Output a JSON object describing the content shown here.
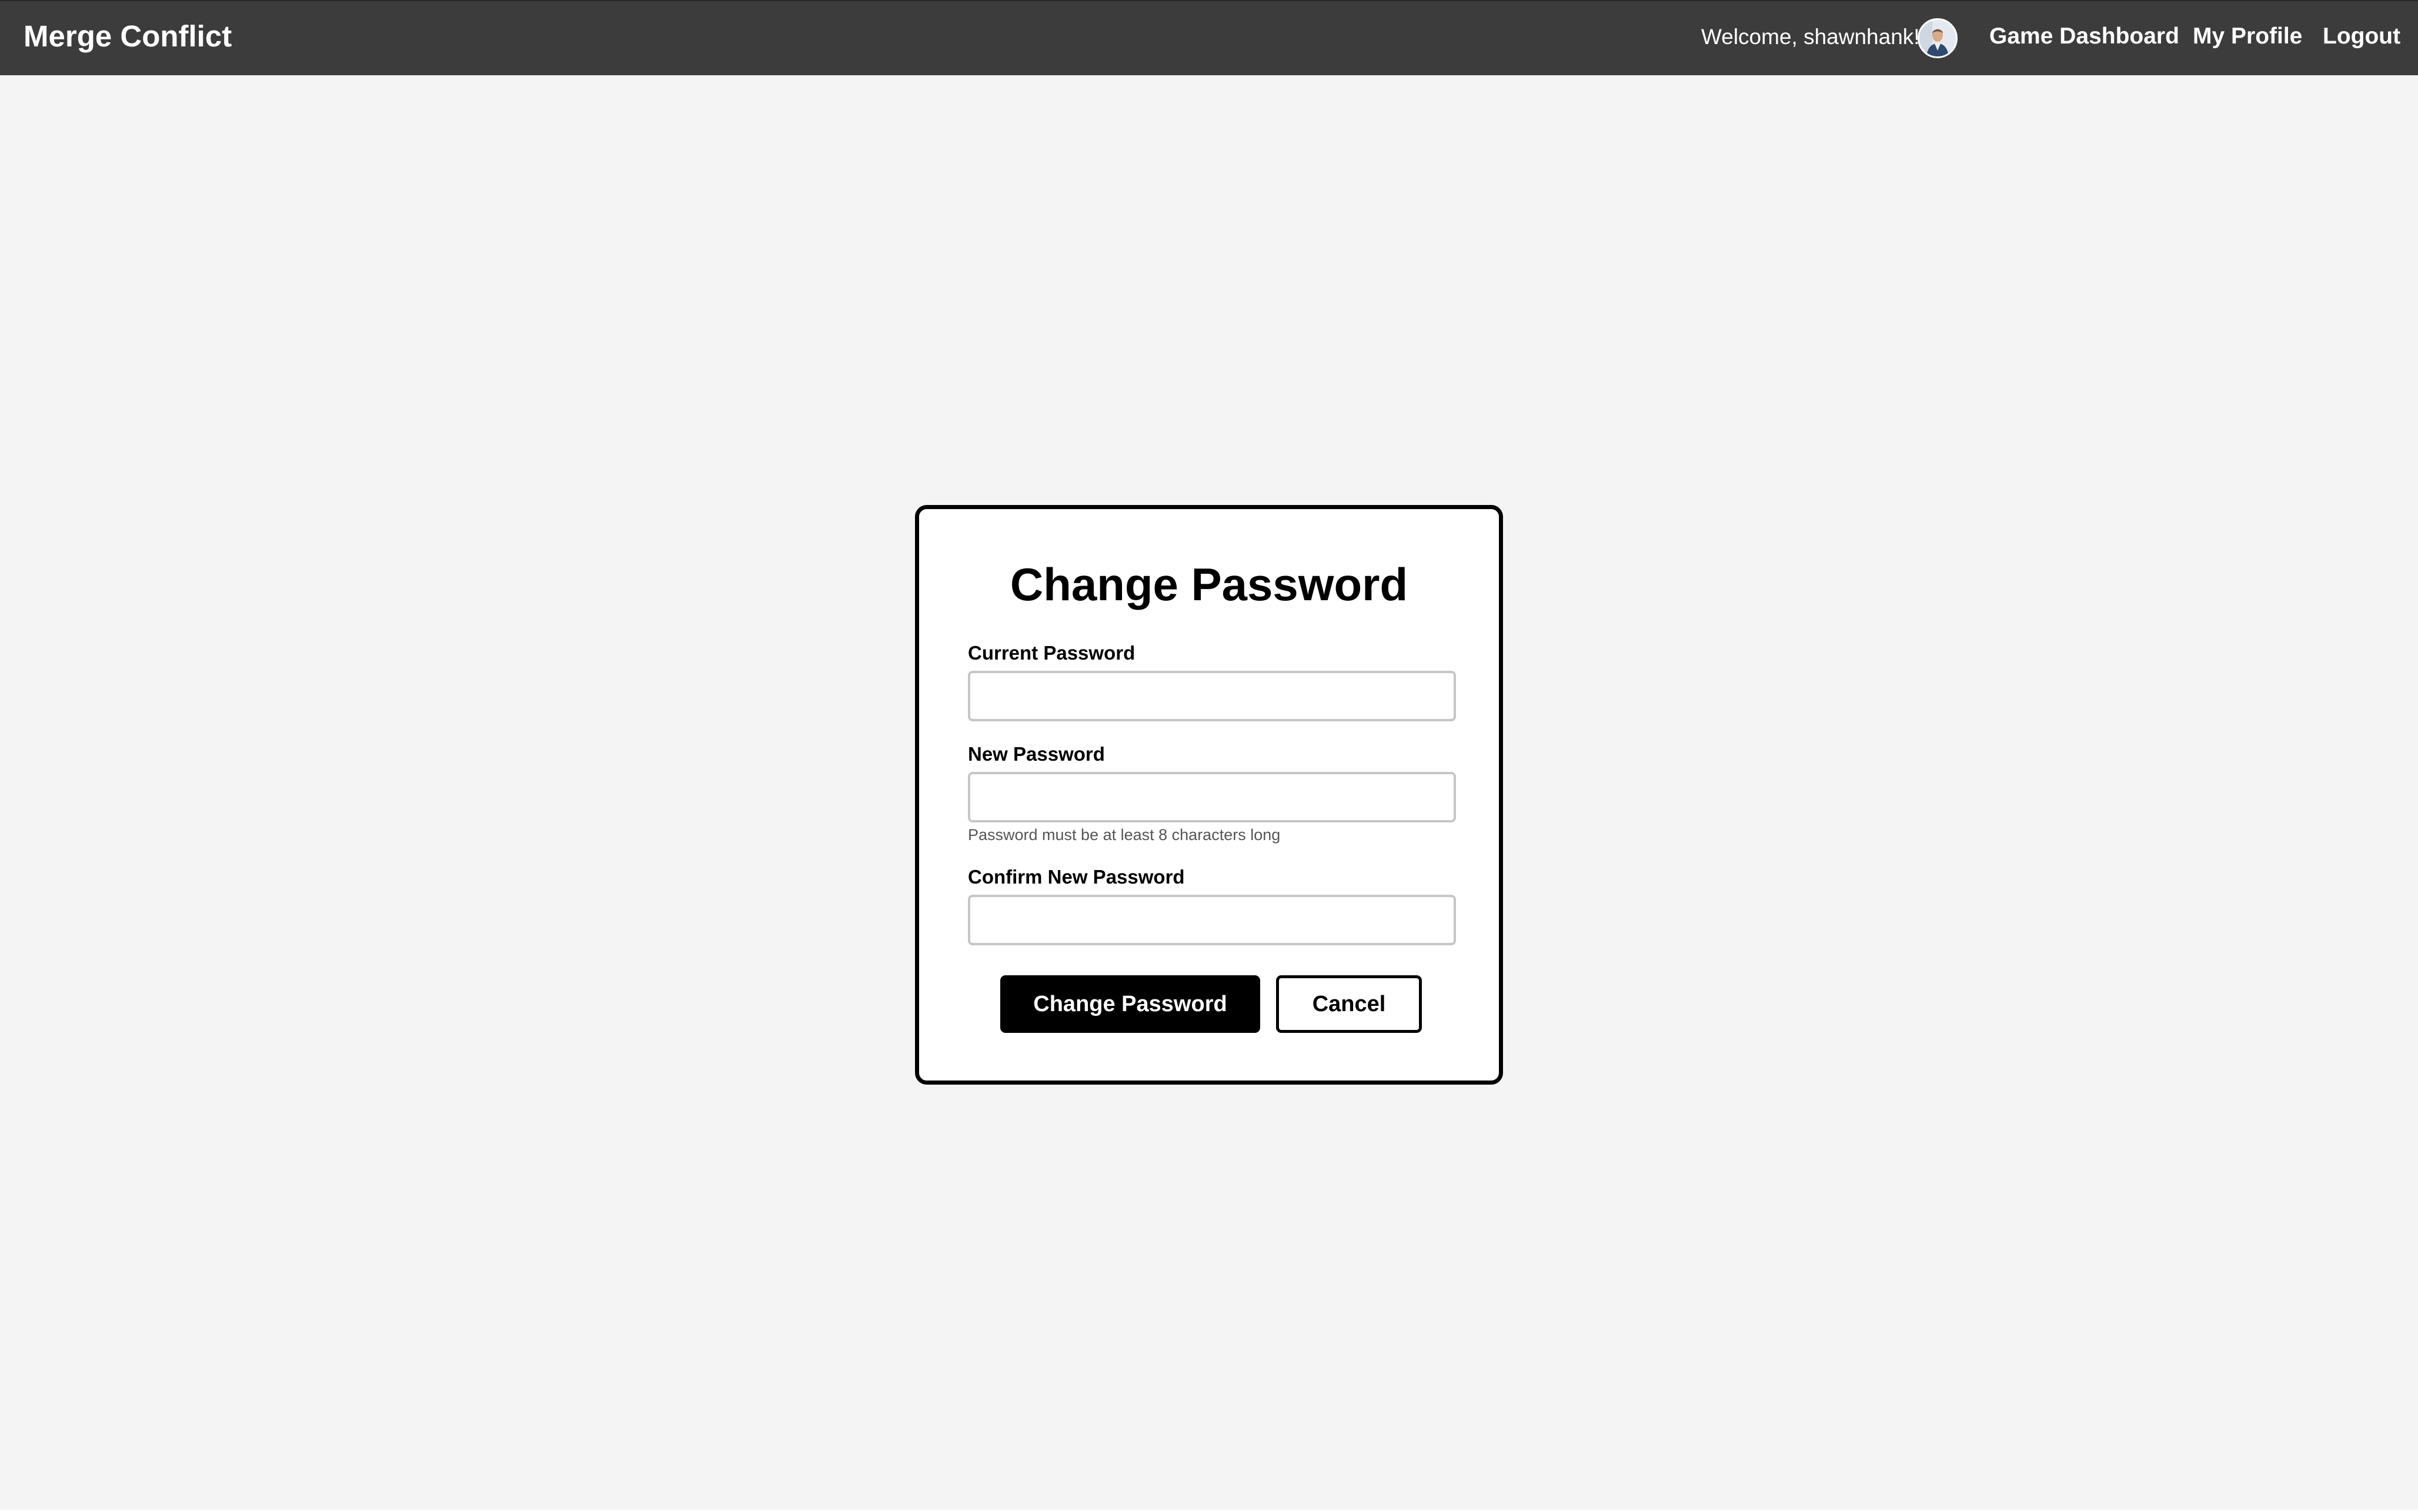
{
  "header": {
    "brand": "Merge Conflict",
    "welcome_text": "Welcome, shawnhank!",
    "avatar_icon": "user-avatar-photo",
    "nav": {
      "dashboard": "Game Dashboard",
      "profile": "My Profile",
      "logout": "Logout"
    }
  },
  "form": {
    "title": "Change Password",
    "current_password": {
      "label": "Current Password",
      "value": "",
      "placeholder": ""
    },
    "new_password": {
      "label": "New Password",
      "value": "",
      "placeholder": "",
      "hint": "Password must be at least 8 characters long"
    },
    "confirm_password": {
      "label": "Confirm New Password",
      "value": "",
      "placeholder": ""
    },
    "submit_label": "Change Password",
    "cancel_label": "Cancel"
  },
  "colors": {
    "navbar_bg": "#3c3c3c",
    "page_bg": "#f4f4f4",
    "primary_button": "#000000",
    "card_border": "#000000"
  }
}
